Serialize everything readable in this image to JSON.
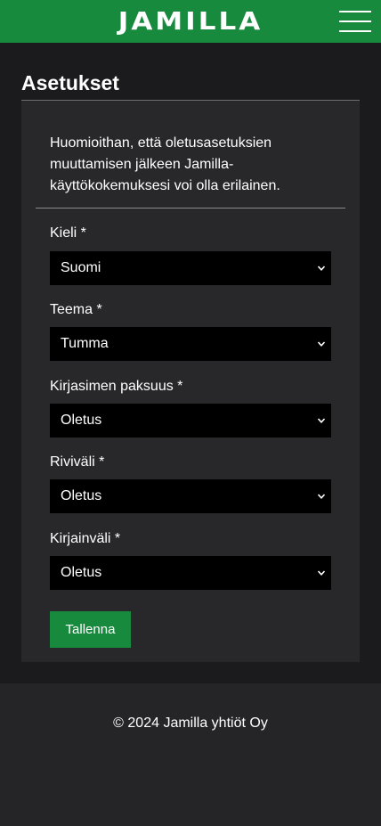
{
  "header": {
    "logo_text": "JAMILLA",
    "brand_color": "#188a3e",
    "menu_icon": "hamburger-menu-icon"
  },
  "page": {
    "title": "Asetukset"
  },
  "settings": {
    "notice": "Huomioithan, että oletusasetuksien muuttamisen jälkeen Jamilla-käyttökokemuksesi voi olla erilainen.",
    "fields": [
      {
        "label": "Kieli *",
        "value": "Suomi"
      },
      {
        "label": "Teema *",
        "value": "Tumma"
      },
      {
        "label": "Kirjasimen paksuus *",
        "value": "Oletus"
      },
      {
        "label": "Riviväli *",
        "value": "Oletus"
      },
      {
        "label": "Kirjainväli *",
        "value": "Oletus"
      }
    ],
    "save_label": "Tallenna"
  },
  "footer": {
    "copyright": "© 2024 Jamilla yhtiöt Oy"
  }
}
